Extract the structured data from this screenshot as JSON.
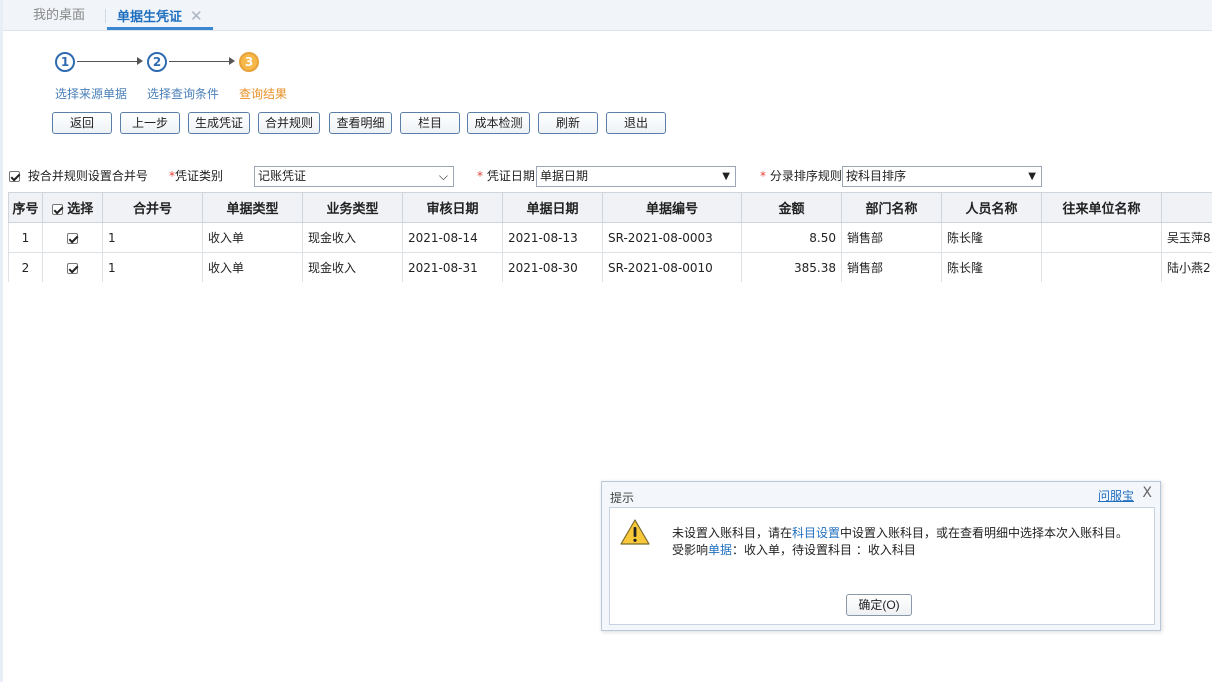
{
  "tabs": {
    "home": "我的桌面",
    "active": "单据生凭证",
    "close": "✕"
  },
  "steps": [
    {
      "num": "1",
      "label": "选择来源单据"
    },
    {
      "num": "2",
      "label": "选择查询条件"
    },
    {
      "num": "3",
      "label": "查询结果"
    }
  ],
  "toolbar": {
    "back": "返回",
    "prev": "上一步",
    "generate": "生成凭证",
    "merge_rule": "合并规则",
    "detail": "查看明细",
    "columns": "栏目",
    "cost_check": "成本检测",
    "refresh": "刷新",
    "exit": "退出"
  },
  "filters": {
    "merge_checkbox_label": "按合并规则设置合并号",
    "voucher_type_label": "凭证类别",
    "voucher_type_value": "记账凭证",
    "voucher_date_label": "凭证日期",
    "voucher_date_value": "单据日期",
    "sort_rule_label": "分录排序规则",
    "sort_rule_value": "按科目排序"
  },
  "table": {
    "headers": [
      "序号",
      "选择",
      "合并号",
      "单据类型",
      "业务类型",
      "审核日期",
      "单据日期",
      "单据编号",
      "金额",
      "部门名称",
      "人员名称",
      "往来单位名称",
      ""
    ],
    "rows": [
      {
        "seq": "1",
        "merge": "1",
        "doc_type": "收入单",
        "biz_type": "现金收入",
        "audit_date": "2021-08-14",
        "doc_date": "2021-08-13",
        "doc_no": "SR-2021-08-0003",
        "amount": "8.50",
        "dept": "销售部",
        "person": "陈长隆",
        "partner": "",
        "extra": "吴玉萍8"
      },
      {
        "seq": "2",
        "merge": "1",
        "doc_type": "收入单",
        "biz_type": "现金收入",
        "audit_date": "2021-08-31",
        "doc_date": "2021-08-30",
        "doc_no": "SR-2021-08-0010",
        "amount": "385.38",
        "dept": "销售部",
        "person": "陈长隆",
        "partner": "",
        "extra": "陆小燕2"
      }
    ]
  },
  "dialog": {
    "title": "提示",
    "help": "问服宝",
    "close": "X",
    "msg1_a": "未设置入账科目，请在",
    "msg1_link": "科目设置",
    "msg1_b": "中设置入账科目，或在查看明细中选择本次入账科目。",
    "msg2_a": "受影响",
    "msg2_link": "单据",
    "msg2_b": "：收入单，待设置科目 ：收入科目",
    "ok": "确定(O)"
  }
}
